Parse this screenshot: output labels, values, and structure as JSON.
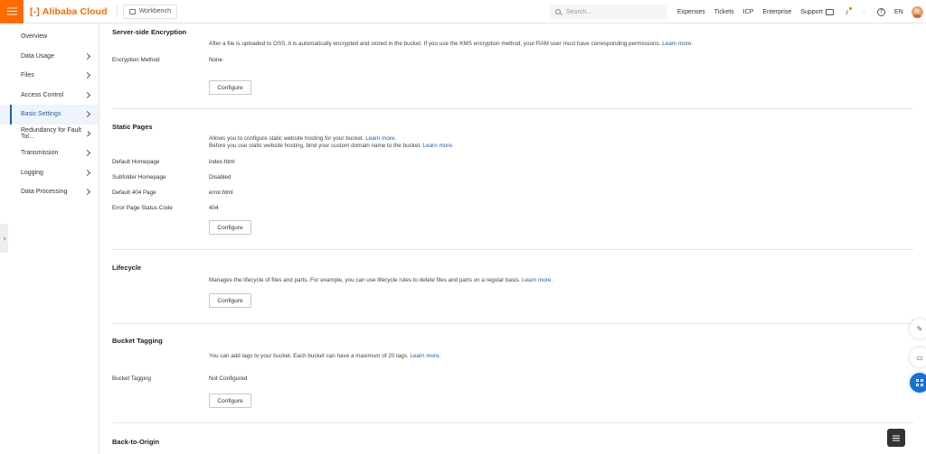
{
  "topbar": {
    "brand": "Alibaba Cloud",
    "workbench": "Workbench",
    "search_placeholder": "Search...",
    "links": [
      "Expenses",
      "Tickets",
      "ICP",
      "Enterprise",
      "Support"
    ],
    "language": "EN",
    "accent_color": "#ff6a00"
  },
  "sidebar": {
    "items": [
      {
        "label": "Overview"
      },
      {
        "label": "Data Usage"
      },
      {
        "label": "Files"
      },
      {
        "label": "Access Control"
      },
      {
        "label": "Basic Settings"
      },
      {
        "label": "Redundancy for Fault Tol..."
      },
      {
        "label": "Transmission"
      },
      {
        "label": "Logging"
      },
      {
        "label": "Data Processing"
      }
    ],
    "active_color": "#1a5fb4"
  },
  "encryption": {
    "title": "Server-side Encryption",
    "desc": "After a file is uploaded to OSS, it is automatically encrypted and stored in the bucket. If you use the KMS encryption method, your RAM user must have corresponding permissions.",
    "learn_more": "Learn more.",
    "method_label": "Encryption Method",
    "method_value": "None",
    "configure": "Configure"
  },
  "static_pages": {
    "title": "Static Pages",
    "desc1": "Allows you to configure static website hosting for your bucket.",
    "desc2": "Before you use static website hosting, bind your custom domain name to the bucket.",
    "learn_more": "Learn more.",
    "rows": [
      {
        "label": "Default Homepage",
        "value": "index.html"
      },
      {
        "label": "Subfolder Homepage",
        "value": "Disabled"
      },
      {
        "label": "Default 404 Page",
        "value": "error.html"
      },
      {
        "label": "Error Page Status Code",
        "value": "404"
      }
    ],
    "configure": "Configure"
  },
  "lifecycle": {
    "title": "Lifecycle",
    "desc": "Manages the lifecycle of files and parts. For example, you can use lifecycle rules to delete files and parts on a regular basis.",
    "learn_more": "Learn more.",
    "configure": "Configure"
  },
  "tagging": {
    "title": "Bucket Tagging",
    "desc": "You can add tags to your bucket. Each bucket can have a maximum of 20 tags.",
    "learn_more": "Learn more.",
    "label": "Bucket Tagging",
    "value": "Not Configured",
    "configure": "Configure"
  },
  "back_to_origin": {
    "title": "Back-to-Origin"
  }
}
